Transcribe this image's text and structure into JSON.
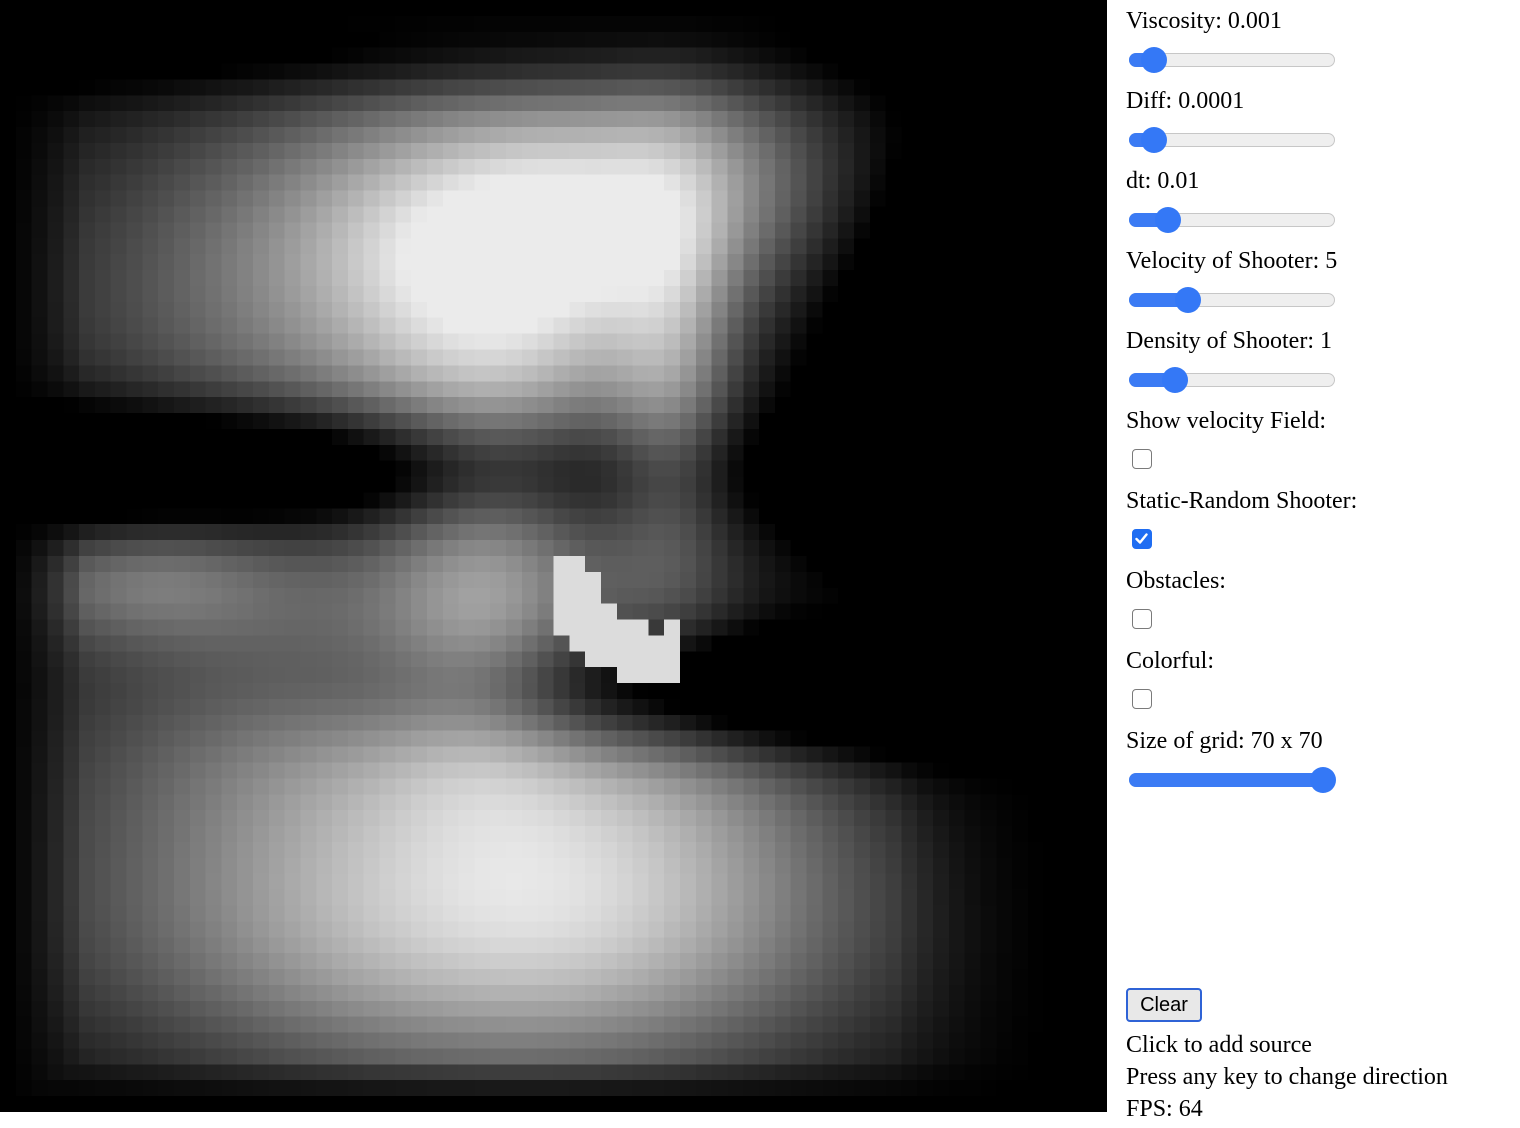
{
  "sliders": [
    {
      "label": "Viscosity: 0.001",
      "value_fraction": 0.06
    },
    {
      "label": "Diff: 0.0001",
      "value_fraction": 0.06
    },
    {
      "label": "dt: 0.01",
      "value_fraction": 0.14
    },
    {
      "label": "Velocity of Shooter: 5",
      "value_fraction": 0.25
    },
    {
      "label": "Density of Shooter: 1",
      "value_fraction": 0.18
    }
  ],
  "checkboxes": [
    {
      "label": "Show velocity Field:",
      "checked": false
    },
    {
      "label": "Static-Random Shooter:",
      "checked": true
    },
    {
      "label": "Obstacles:",
      "checked": false
    },
    {
      "label": "Colorful:",
      "checked": false
    }
  ],
  "grid_size": {
    "label": "Size of grid: 70 x 70",
    "value_fraction": 1.0
  },
  "clear_label": "Clear",
  "info": {
    "hint_click": "Click to add source",
    "hint_key": "Press any key to change direction",
    "fps": "FPS: 64"
  },
  "colors": {
    "accent": "#3478f6",
    "slider_track": "#efefef"
  },
  "grid_resolution": 70
}
